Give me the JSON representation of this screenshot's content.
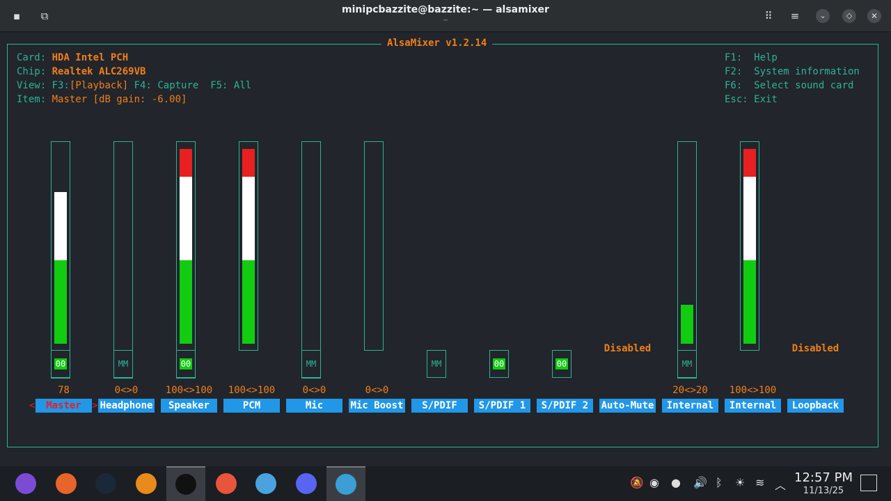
{
  "window": {
    "title": "minipcbazzite@bazzite:~ — alsamixer",
    "subtitle": "~"
  },
  "mixer": {
    "app_title": "AlsaMixer v1.2.14",
    "card_label": "Card:",
    "card": "HDA Intel PCH",
    "chip_label": "Chip:",
    "chip": "Realtek ALC269VB",
    "view_label": "View:",
    "view_f3": "F3:",
    "view_playback": "[Playback]",
    "view_f4": "F4: Capture",
    "view_f5": "F5: All",
    "item_label": "Item:",
    "item": "Master [dB gain: -6.00]",
    "help": [
      "F1:  Help",
      "F2:  System information",
      "F6:  Select sound card",
      "Esc: Exit"
    ],
    "colors": {
      "green": "#12cc12",
      "white": "#ffffff",
      "red": "#e82020",
      "accent": "#2bb39a",
      "orange": "#f07f19",
      "label_bg": "#2197e8"
    },
    "controls": [
      {
        "name": "Master",
        "value": "78",
        "level": 78,
        "mute": "00",
        "selected": true
      },
      {
        "name": "Headphone",
        "value": "0<>0",
        "level": 0,
        "mute": "MM"
      },
      {
        "name": "Speaker",
        "value": "100<>100",
        "level": 100,
        "mute": "00"
      },
      {
        "name": "PCM",
        "value": "100<>100",
        "level": 100
      },
      {
        "name": "Mic",
        "value": "0<>0",
        "level": 0,
        "mute": "MM"
      },
      {
        "name": "Mic Boost",
        "value": "0<>0",
        "level": 0
      },
      {
        "name": "S/PDIF",
        "mute": "MM"
      },
      {
        "name": "S/PDIF 1",
        "mute": "00"
      },
      {
        "name": "S/PDIF 2",
        "mute": "00"
      },
      {
        "name": "Auto-Mute",
        "enum": "Disabled"
      },
      {
        "name": "Internal",
        "value": "20<>20",
        "level": 20,
        "mute": "MM"
      },
      {
        "name": "Internal",
        "value": "100<>100",
        "level": 100
      },
      {
        "name": "Loopback",
        "enum": "Disabled"
      }
    ]
  },
  "taskbar": {
    "apps": [
      "bazzite-portal",
      "firefox",
      "steam",
      "lutris",
      "konsole",
      "extensions",
      "files",
      "discord",
      "screenshot"
    ],
    "time": "12:57 PM",
    "date": "11/13/25"
  }
}
